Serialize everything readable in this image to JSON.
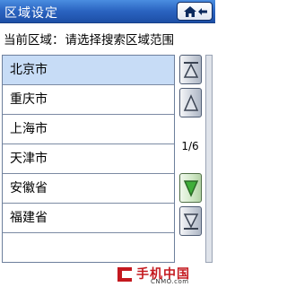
{
  "titlebar": {
    "title": "区域设定",
    "home_icon": "home-back-icon"
  },
  "current": {
    "label": "当前区域：",
    "value": "请选择搜索区域范围"
  },
  "list": {
    "items": [
      {
        "label": "北京市",
        "selected": true
      },
      {
        "label": "重庆市",
        "selected": false
      },
      {
        "label": "上海市",
        "selected": false
      },
      {
        "label": "天津市",
        "selected": false
      },
      {
        "label": "安徽省",
        "selected": false
      },
      {
        "label": "福建省",
        "selected": false
      }
    ]
  },
  "scroll": {
    "page_indicator": "1/6",
    "buttons": [
      "scroll-top-icon",
      "scroll-up-icon",
      "scroll-down-icon",
      "scroll-bottom-icon"
    ]
  },
  "watermark": {
    "text": "手机中国",
    "sub": "CNMO.com"
  },
  "colors": {
    "titlebar": "#2a63c0",
    "selected_row": "#c7dcf6",
    "watermark": "#c4191f"
  }
}
